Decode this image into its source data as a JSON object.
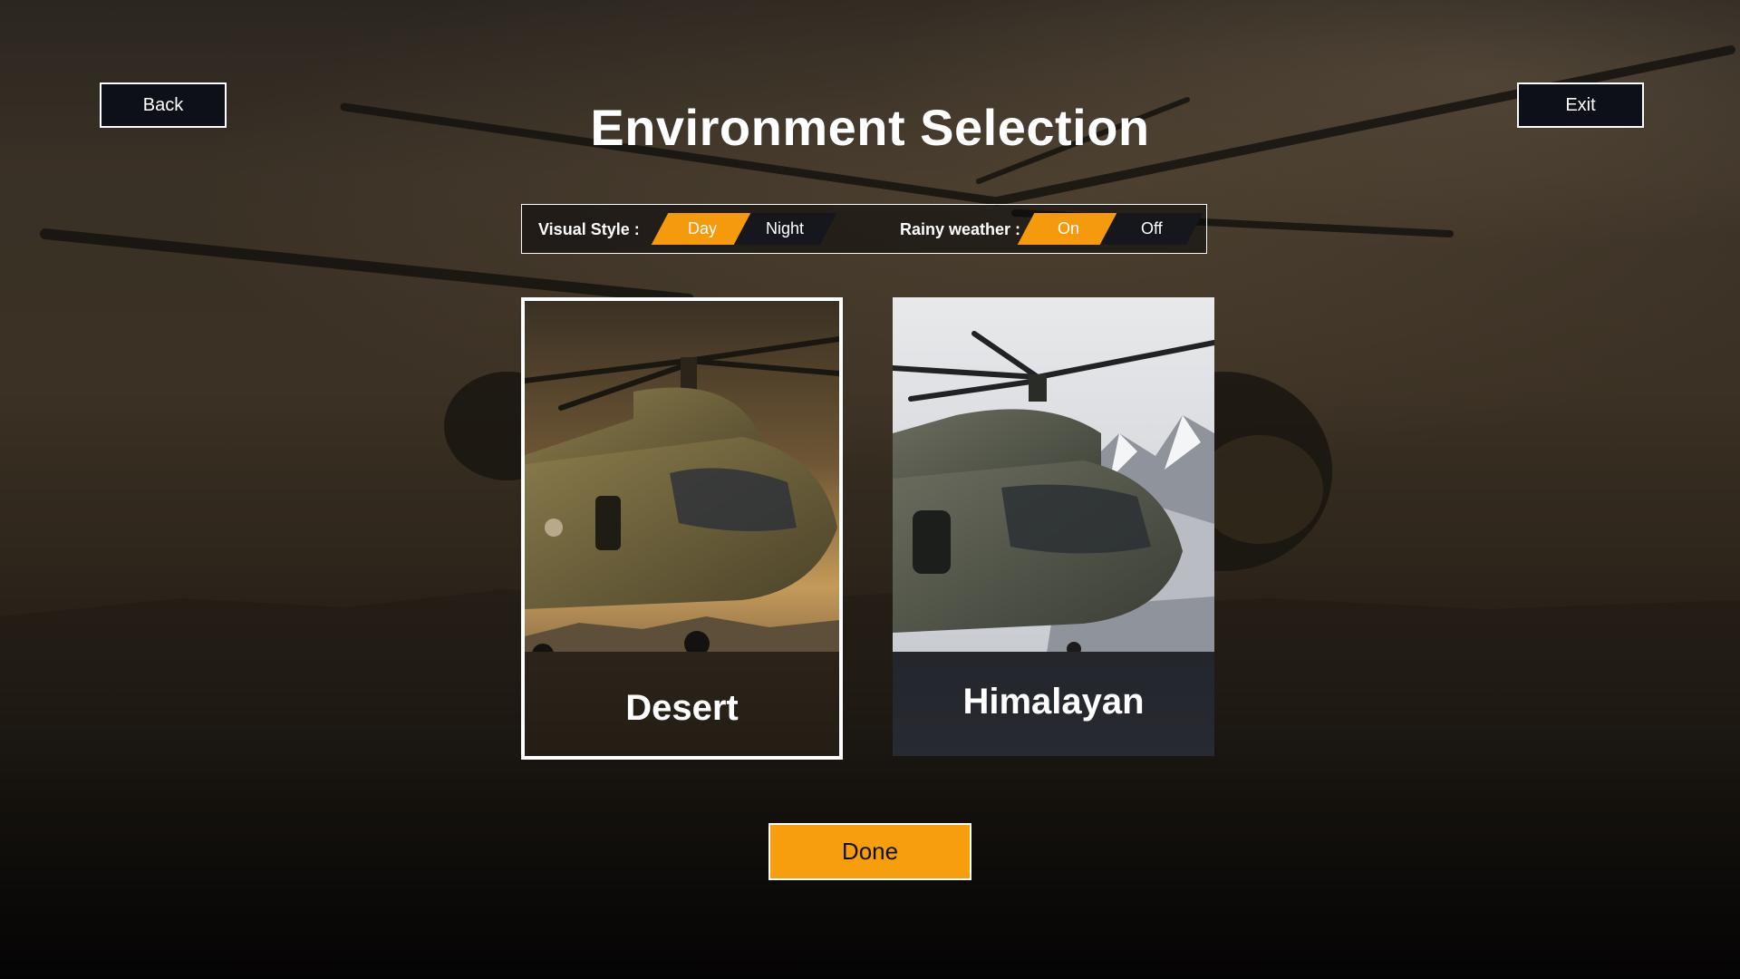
{
  "header": {
    "title": "Environment Selection",
    "back_label": "Back",
    "exit_label": "Exit"
  },
  "settings": {
    "visual_style": {
      "label": "Visual Style :",
      "options": [
        "Day",
        "Night"
      ],
      "selected": "Day"
    },
    "rainy_weather": {
      "label": "Rainy weather :",
      "options": [
        "On",
        "Off"
      ],
      "selected": "On"
    }
  },
  "environments": [
    {
      "name": "Desert",
      "selected": true
    },
    {
      "name": "Himalayan",
      "selected": false
    }
  ],
  "footer": {
    "done_label": "Done"
  },
  "colors": {
    "accent": "#f59a0c",
    "button_dark": "#0d1018",
    "border": "#ffffff"
  }
}
